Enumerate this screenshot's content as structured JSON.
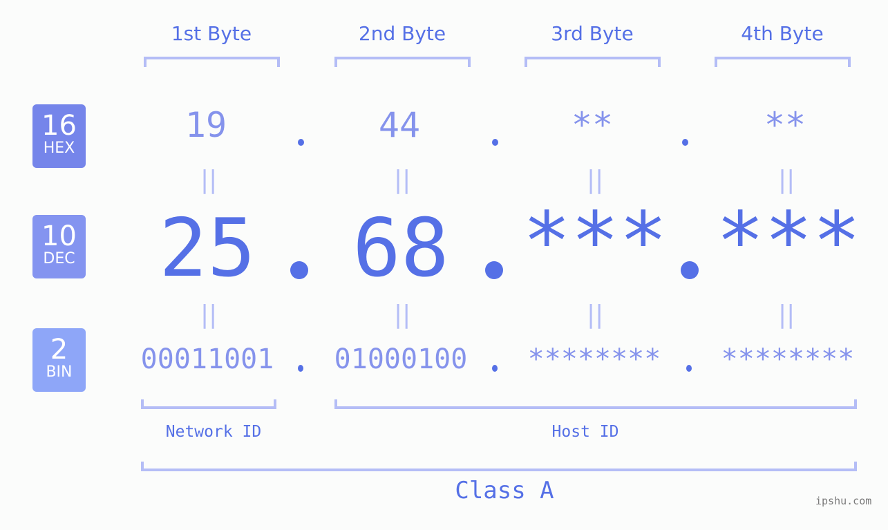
{
  "byte_headers": [
    "1st Byte",
    "2nd Byte",
    "3rd Byte",
    "4th Byte"
  ],
  "rows": {
    "hex": {
      "base": "16",
      "label": "HEX",
      "color": "#7585ea",
      "values": [
        "19",
        "44",
        "**",
        "**"
      ]
    },
    "dec": {
      "base": "10",
      "label": "DEC",
      "color": "#8494f0",
      "values": [
        "25",
        "68",
        "***",
        "***"
      ]
    },
    "bin": {
      "base": "2",
      "label": "BIN",
      "color": "#8ea6f8",
      "values": [
        "00011001",
        "01000100",
        "********",
        "********"
      ]
    }
  },
  "separator": ".",
  "equals_symbol": "||",
  "segments": {
    "network": "Network ID",
    "host": "Host ID"
  },
  "ip_class": "Class A",
  "watermark": "ipshu.com",
  "colors": {
    "accent": "#5570e6",
    "light_accent": "#8593ec",
    "bracket": "#b4bdf6"
  }
}
